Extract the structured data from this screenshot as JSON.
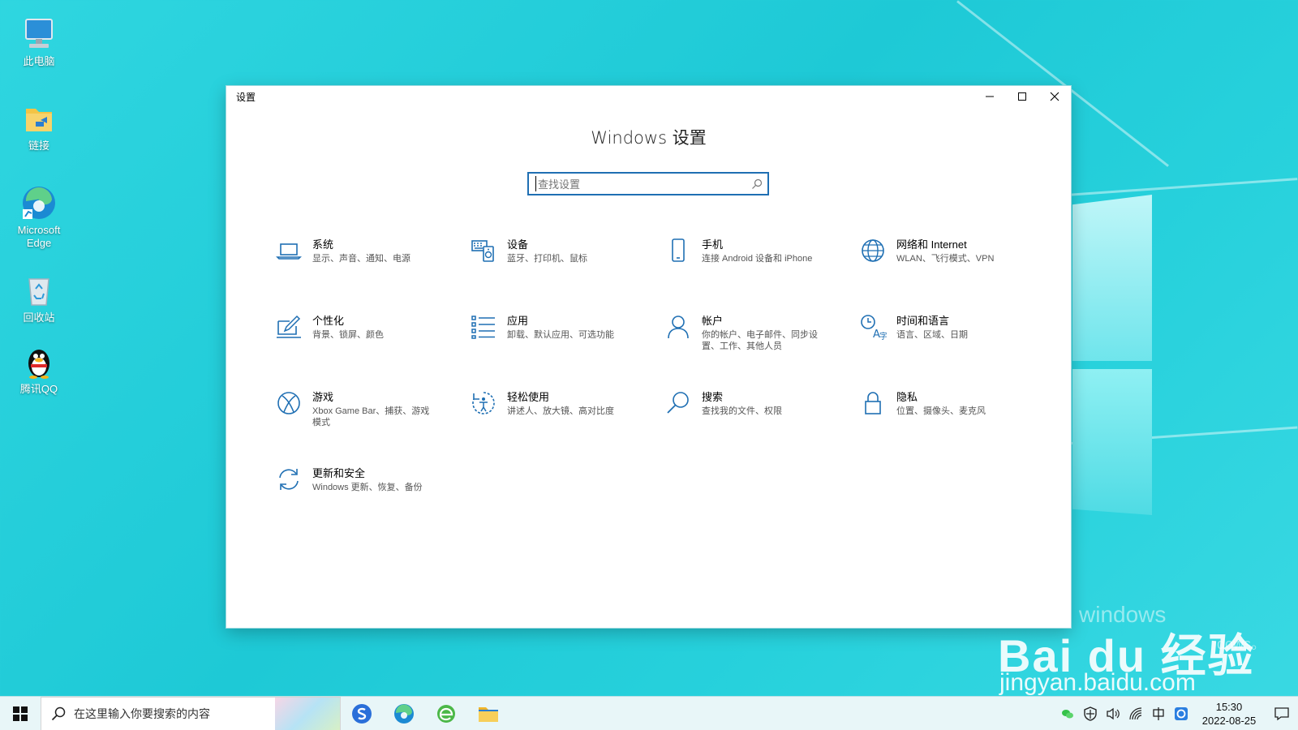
{
  "desktop": {
    "icons": [
      {
        "label": "此电脑",
        "icon": "computer-icon"
      },
      {
        "label": "链接",
        "icon": "folder-link-icon"
      },
      {
        "label": "Microsoft Edge",
        "icon": "edge-icon"
      },
      {
        "label": "回收站",
        "icon": "recycle-bin-icon"
      },
      {
        "label": "腾讯QQ",
        "icon": "qq-penguin-icon"
      }
    ]
  },
  "window": {
    "title": "设置",
    "heading": "Windows 设置",
    "search_placeholder": "查找设置",
    "accent": "#1f6fb3",
    "tiles": [
      {
        "title": "系统",
        "desc": "显示、声音、通知、电源",
        "icon": "laptop-icon"
      },
      {
        "title": "设备",
        "desc": "蓝牙、打印机、鼠标",
        "icon": "devices-icon"
      },
      {
        "title": "手机",
        "desc": "连接 Android 设备和 iPhone",
        "icon": "phone-icon"
      },
      {
        "title": "网络和 Internet",
        "desc": "WLAN、飞行模式、VPN",
        "icon": "globe-icon"
      },
      {
        "title": "个性化",
        "desc": "背景、锁屏、颜色",
        "icon": "personalize-icon"
      },
      {
        "title": "应用",
        "desc": "卸载、默认应用、可选功能",
        "icon": "apps-list-icon"
      },
      {
        "title": "帐户",
        "desc": "你的帐户、电子邮件、同步设置、工作、其他人员",
        "icon": "person-icon"
      },
      {
        "title": "时间和语言",
        "desc": "语言、区域、日期",
        "icon": "time-language-icon"
      },
      {
        "title": "游戏",
        "desc": "Xbox Game Bar、捕获、游戏模式",
        "icon": "xbox-icon"
      },
      {
        "title": "轻松使用",
        "desc": "讲述人、放大镜、高对比度",
        "icon": "ease-of-access-icon"
      },
      {
        "title": "搜索",
        "desc": "查找我的文件、权限",
        "icon": "search-icon"
      },
      {
        "title": "隐私",
        "desc": "位置、摄像头、麦克风",
        "icon": "lock-icon"
      },
      {
        "title": "更新和安全",
        "desc": "Windows 更新、恢复、备份",
        "icon": "update-icon"
      }
    ]
  },
  "taskbar": {
    "search_text": "在这里输入你要搜索的内容",
    "time": "15:30",
    "date": "2022-08-25"
  },
  "watermark": {
    "brand": "Bai du 经验",
    "url": "jingyan.baidu.com",
    "faint_1": "windows",
    "faint_2": "dows。"
  }
}
